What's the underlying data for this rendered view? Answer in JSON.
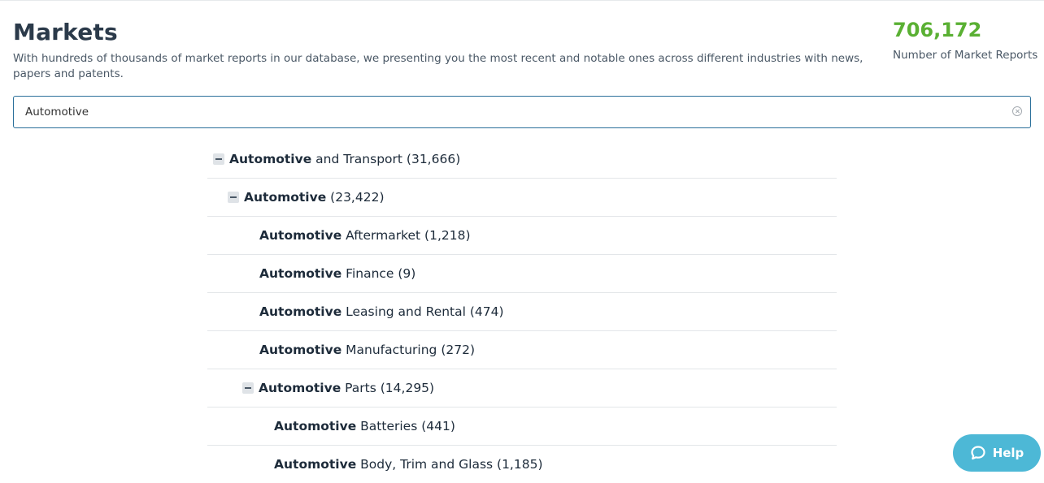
{
  "header": {
    "title": "Markets",
    "description": "With hundreds of thousands of market reports in our database, we presenting you the most recent and notable ones across different industries with news, papers and patents.",
    "report_count": "706,172",
    "report_count_label": "Number of Market Reports"
  },
  "search": {
    "value": "Automotive",
    "clear_icon": "clear-circle-icon"
  },
  "tree": [
    {
      "level": "l0",
      "collapsible": true,
      "match": "Automotive",
      "rest": " and Transport (31,666)"
    },
    {
      "level": "l1",
      "collapsible": true,
      "match": "Automotive",
      "rest": " (23,422)"
    },
    {
      "level": "l2",
      "collapsible": false,
      "match": "Automotive",
      "rest": " Aftermarket (1,218)"
    },
    {
      "level": "l2",
      "collapsible": false,
      "match": "Automotive",
      "rest": " Finance (9)"
    },
    {
      "level": "l2",
      "collapsible": false,
      "match": "Automotive",
      "rest": " Leasing and Rental (474)"
    },
    {
      "level": "l2",
      "collapsible": false,
      "match": "Automotive",
      "rest": " Manufacturing (272)"
    },
    {
      "level": "l2c",
      "collapsible": true,
      "match": "Automotive",
      "rest": " Parts (14,295)"
    },
    {
      "level": "l3",
      "collapsible": false,
      "match": "Automotive",
      "rest": " Batteries (441)"
    },
    {
      "level": "l3",
      "collapsible": false,
      "match": "Automotive",
      "rest": " Body, Trim and Glass (1,185)"
    }
  ],
  "help": {
    "label": "Help",
    "icon": "chat-bubble-icon",
    "color": "#4db8d6"
  },
  "colors": {
    "accent_green": "#5ab033",
    "search_border": "#2a6f9a"
  }
}
